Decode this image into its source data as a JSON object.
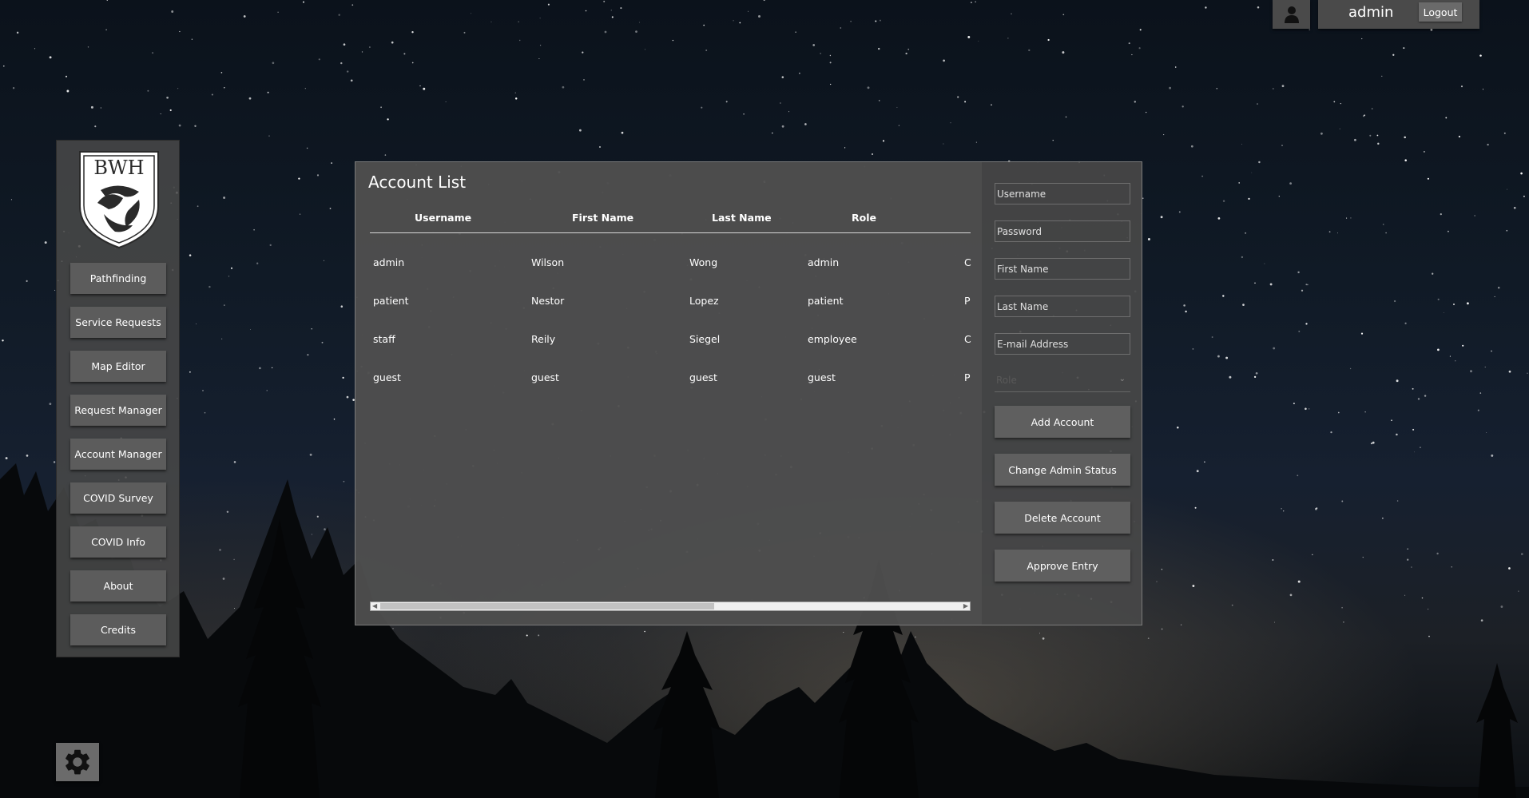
{
  "user": {
    "name": "admin",
    "logout_label": "Logout"
  },
  "logo": {
    "text": "BWH"
  },
  "sidebar": {
    "items": [
      {
        "label": "Pathfinding"
      },
      {
        "label": "Service Requests"
      },
      {
        "label": "Map Editor"
      },
      {
        "label": "Request Manager"
      },
      {
        "label": "Account Manager"
      },
      {
        "label": "COVID Survey"
      },
      {
        "label": "COVID Info"
      },
      {
        "label": "About"
      },
      {
        "label": "Credits"
      }
    ]
  },
  "account_list": {
    "title": "Account List",
    "columns": [
      "Username",
      "First Name",
      "Last Name",
      "Role"
    ],
    "rows": [
      {
        "username": "admin",
        "first": "Wilson",
        "last": "Wong",
        "role": "admin",
        "extra": "C"
      },
      {
        "username": "patient",
        "first": "Nestor",
        "last": "Lopez",
        "role": "patient",
        "extra": "P"
      },
      {
        "username": "staff",
        "first": "Reily",
        "last": "Siegel",
        "role": "employee",
        "extra": "C"
      },
      {
        "username": "guest",
        "first": "guest",
        "last": "guest",
        "role": "guest",
        "extra": "P"
      }
    ]
  },
  "form": {
    "username_placeholder": "Username",
    "password_placeholder": "Password",
    "first_name_placeholder": "First Name",
    "last_name_placeholder": "Last Name",
    "email_placeholder": "E-mail Address",
    "role_placeholder": "Role",
    "add_label": "Add Account",
    "change_admin_label": "Change Admin Status",
    "delete_label": "Delete Account",
    "approve_label": "Approve Entry"
  },
  "icons": {
    "settings": "gear-icon",
    "user": "user-icon"
  }
}
